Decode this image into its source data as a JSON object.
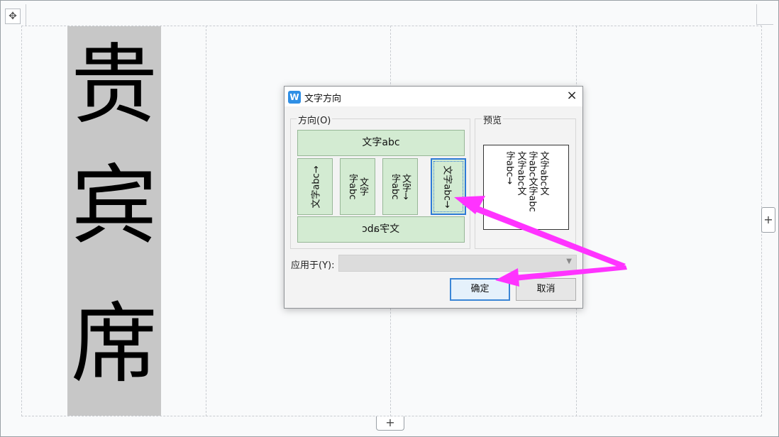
{
  "document": {
    "cell_chars": [
      "贵",
      "宾",
      "席"
    ],
    "add_column_label": "+",
    "add_row_label": "+"
  },
  "dialog": {
    "title": "文字方向",
    "app_icon_letter": "W",
    "close_label": "×",
    "direction_group": {
      "label": "方向(O)",
      "options": {
        "horizontal": "文字abc",
        "rotate_ccw": "文字abc→",
        "vertical_rtl": "文字\n字abc",
        "vertical_stacked": "文字→\n字abc",
        "rotate_cw": "文字abc→",
        "horizontal_mirror": "文字abc"
      },
      "selected": "rotate_cw"
    },
    "preview_group": {
      "label": "预览",
      "text": "文字abc文\n字abc文字abc\n文字abc文\n字abc→"
    },
    "apply_to": {
      "label": "应用于(Y):",
      "value": ""
    },
    "ok_label": "确定",
    "cancel_label": "取消"
  },
  "annotations": {
    "arrow_color": "#ff33ff"
  },
  "colors": {
    "option_fill": "#d3ebd2",
    "selection_border": "#2e7ad6",
    "cell_shade": "#c7c7c7"
  }
}
